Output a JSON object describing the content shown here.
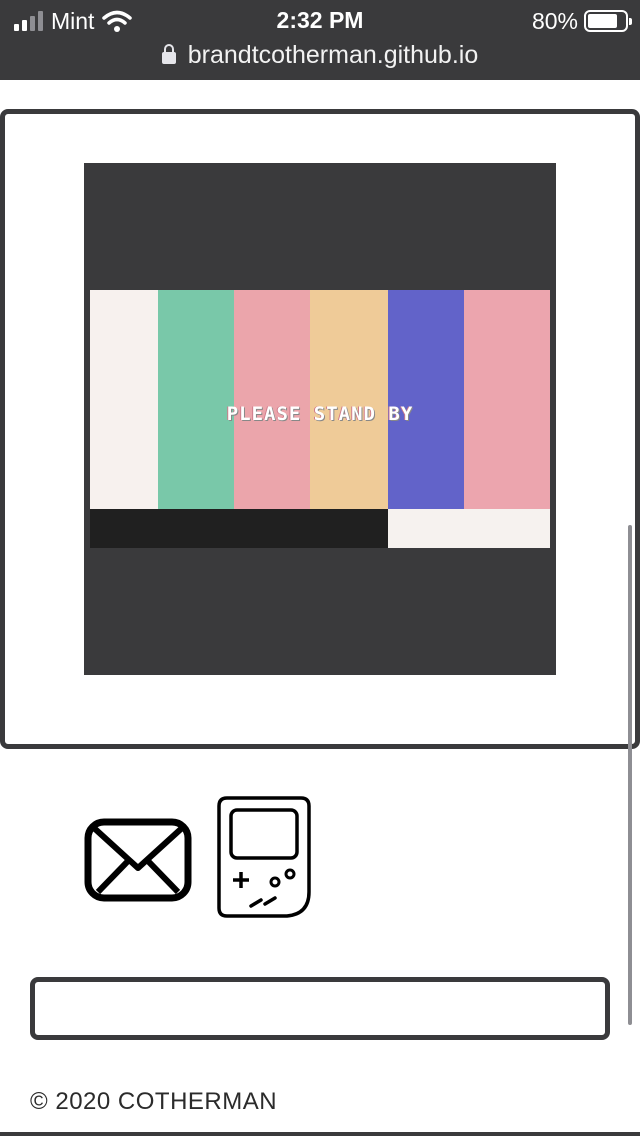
{
  "status_bar": {
    "carrier": "Mint",
    "time": "2:32 PM",
    "battery_percent_label": "80%",
    "battery_level": 0.8,
    "signal_icon": "signal-bars-icon",
    "wifi_icon": "wifi-icon"
  },
  "browser": {
    "url": "brandtcotherman.github.io",
    "lock_icon": "lock-icon"
  },
  "video": {
    "caption": "PLEASE STAND BY",
    "bar_colors": [
      "#f7f1ee",
      "#79c8a9",
      "#eba5ab",
      "#efcb98",
      "#6263c9",
      "#eca5ae"
    ]
  },
  "links": [
    {
      "name": "mail-icon"
    },
    {
      "name": "gameboy-icon"
    }
  ],
  "input": {
    "value": ""
  },
  "footer": {
    "copyright": "© 2020 COTHERMAN"
  },
  "colors": {
    "frame": "#3a3a3c",
    "background": "#ffffff"
  }
}
